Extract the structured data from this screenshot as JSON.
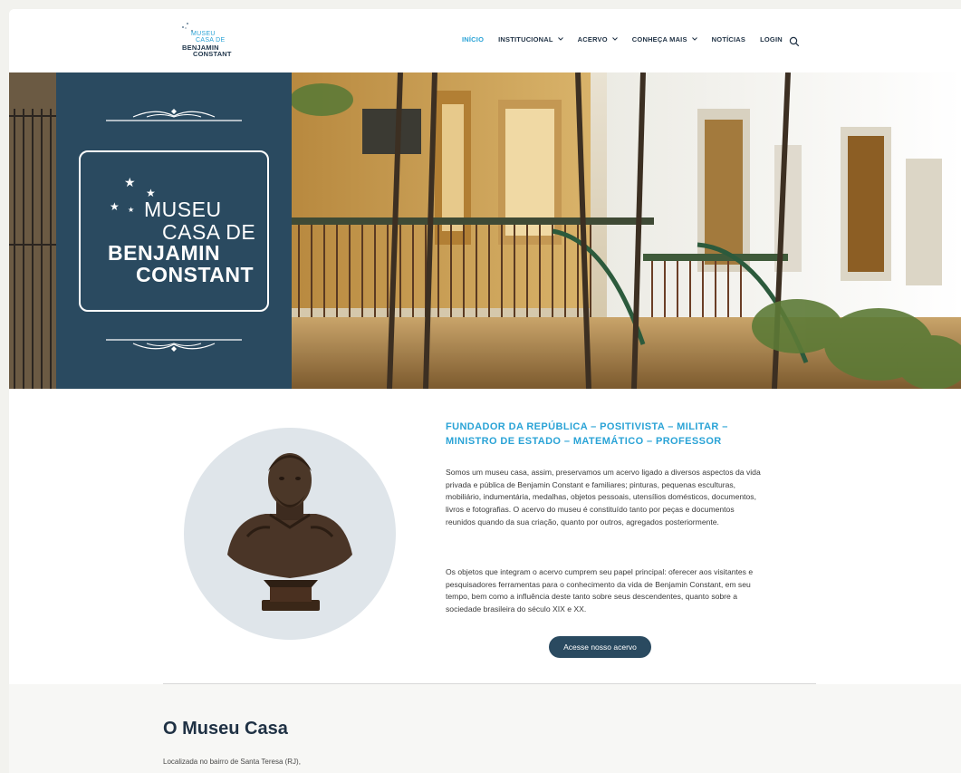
{
  "logo": {
    "stars": "* ·\n* ·",
    "line1": "MUSEU",
    "line2": "CASA DE",
    "line3": "BENJAMIN",
    "line4": "CONSTANT"
  },
  "nav": {
    "items": [
      {
        "label": "INÍCIO",
        "active": true,
        "has_dropdown": false
      },
      {
        "label": "INSTITUCIONAL",
        "active": false,
        "has_dropdown": true
      },
      {
        "label": "ACERVO",
        "active": false,
        "has_dropdown": true
      },
      {
        "label": "CONHEÇA MAIS",
        "active": false,
        "has_dropdown": true
      },
      {
        "label": "NOTÍCIAS",
        "active": false,
        "has_dropdown": false
      },
      {
        "label": "LOGIN",
        "active": false,
        "has_dropdown": false
      }
    ],
    "chevron": "⌄",
    "search_icon": "search-icon"
  },
  "hero": {
    "stars": "★\n★\n★ ★\n★",
    "title_line1": "MUSEU",
    "title_line2": "CASA DE",
    "title_line3": "BENJAMIN",
    "title_line4": "CONSTANT"
  },
  "intro": {
    "heading": "FUNDADOR DA REPÚBLICA – POSITIVISTA – MILITAR – MINISTRO DE ESTADO – MATEMÁTICO – PROFESSOR",
    "paragraph1": "Somos um museu casa, assim, preservamos um acervo ligado a diversos aspectos da vida privada e pública de Benjamin Constant e familiares; pinturas, pequenas esculturas, mobiliário, indumentária, medalhas, objetos pessoais, utensílios domésticos, documentos, livros e fotografias. O acervo do museu é constituído tanto por peças e documentos reunidos quando da sua criação, quanto por outros, agregados posteriormente.",
    "paragraph2": "Os objetos que integram o acervo cumprem seu papel principal: oferecer aos visitantes e pesquisadores ferramentas para o conhecimento da vida de Benjamin Constant, em seu tempo, bem como a influência deste tanto sobre seus descendentes, quanto sobre a sociedade brasileira do século XIX e XX.",
    "cta_label": "Acesse nosso acervo"
  },
  "museu": {
    "title": "O Museu Casa",
    "subtitle": "Localizada no bairro de Santa Teresa (RJ),"
  },
  "colors": {
    "accent": "#2aa3d6",
    "navy": "#2a4a60",
    "text": "#1f3144"
  }
}
